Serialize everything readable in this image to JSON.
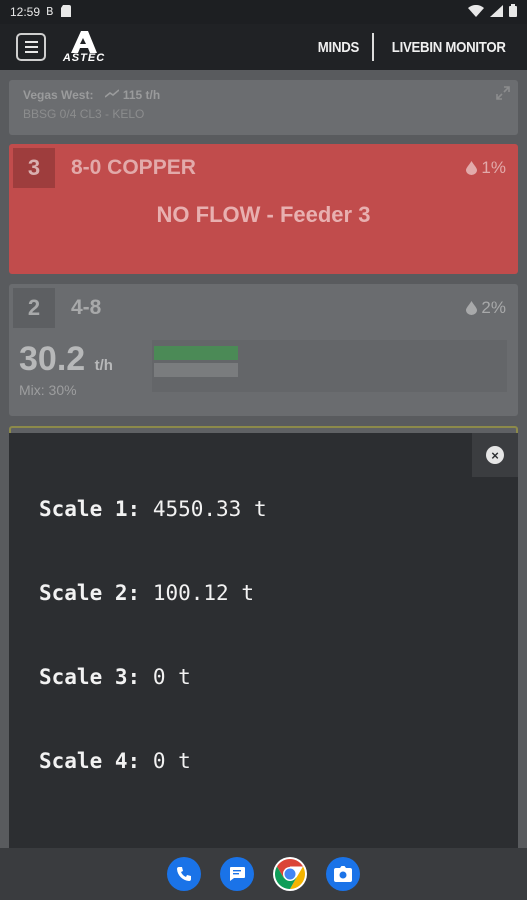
{
  "status_bar": {
    "time": "12:59",
    "left_icons": [
      "sim-b-icon",
      "sd-card-icon"
    ],
    "right_icons": [
      "wifi-icon",
      "signal-icon",
      "battery-icon"
    ]
  },
  "app_bar": {
    "logo_text": "ASTEC",
    "nav_minds": "MINDS",
    "nav_livebin": "LIVEBIN MONITOR"
  },
  "plant": {
    "name": "Vegas West:",
    "rate": "115 t/h",
    "mix": "BBSG 0/4 CL3 - KELO"
  },
  "bins": [
    {
      "number": "3",
      "material": "8-0 COPPER",
      "moisture": "1%",
      "status": "NO FLOW - Feeder 3",
      "color": "#c14c4c"
    },
    {
      "number": "2",
      "material": "4-8",
      "moisture": "2%",
      "rate_value": "30.2",
      "rate_unit": "t/h",
      "mix": "Mix: 30%",
      "actual_fraction": 0.24,
      "target_fraction": 0.24
    }
  ],
  "scales_modal": {
    "close_icon": "close-circle-icon",
    "scales": [
      {
        "label": "Scale 1:",
        "value": "4550.33 t"
      },
      {
        "label": "Scale 2:",
        "value": "100.12 t"
      },
      {
        "label": "Scale 3:",
        "value": "0 t"
      },
      {
        "label": "Scale 4:",
        "value": "0 t"
      }
    ]
  },
  "dock": {
    "apps": [
      "phone-icon",
      "messages-icon",
      "chrome-icon",
      "camera-icon"
    ]
  }
}
